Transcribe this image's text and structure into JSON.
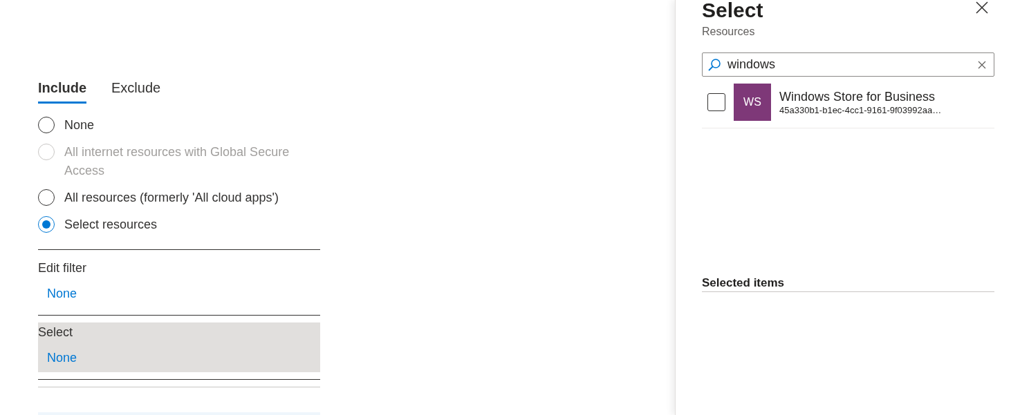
{
  "tabs": [
    {
      "label": "Include",
      "selected": true
    },
    {
      "label": "Exclude",
      "selected": false
    }
  ],
  "options": [
    {
      "label": "None",
      "selected": false,
      "disabled": false
    },
    {
      "label": "All internet resources with Global Secure Access",
      "selected": false,
      "disabled": true
    },
    {
      "label": "All resources (formerly 'All cloud apps')",
      "selected": false,
      "disabled": false
    },
    {
      "label": "Select resources",
      "selected": true,
      "disabled": false
    }
  ],
  "sections": [
    {
      "label": "Edit filter",
      "value": "None",
      "highlighted": false
    },
    {
      "label": "Select",
      "value": "None",
      "highlighted": true
    }
  ],
  "panel": {
    "title": "Select",
    "subtitle": "Resources",
    "search": {
      "value": "windows"
    },
    "results": [
      {
        "initials": "WS",
        "name": "Windows Store for Business",
        "id": "45a330b1-b1ec-4cc1-9161-9f03992aa…",
        "checked": false
      }
    ],
    "selected_heading": "Selected items"
  }
}
